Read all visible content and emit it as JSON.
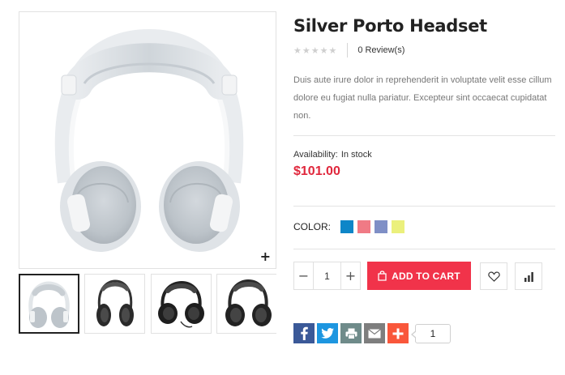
{
  "product": {
    "title": "Silver Porto Headset",
    "reviews_label": "0 Review(s)",
    "rating_stars": "★★★★★",
    "rating": 0,
    "description": "Duis aute irure dolor in reprehenderit in voluptate velit esse cillum dolore eu fugiat nulla pariatur. Excepteur sint occaecat cupidatat non.",
    "availability_label": "Availability:",
    "availability_value": "In stock",
    "price": "$101.00"
  },
  "gallery": {
    "zoom_icon": "+",
    "thumbnails": [
      "white-headphones",
      "black-headphones-1",
      "black-headphones-2",
      "black-headphones-3"
    ]
  },
  "color": {
    "label": "COLOR:",
    "swatches": [
      "#0e86c8",
      "#f07a85",
      "#7f8fc6",
      "#ebf07c"
    ]
  },
  "cart": {
    "quantity": "1",
    "minus": "−",
    "plus": "+",
    "add_to_cart": "ADD TO CART"
  },
  "actions": {
    "wishlist_icon": "heart-icon",
    "compare_icon": "bar-chart-icon"
  },
  "share": {
    "count": "1",
    "colors": {
      "facebook": "#3b5998",
      "twitter": "#1d96e0",
      "print": "#6f8b8a",
      "email": "#7e7e7e",
      "more": "#f9573b"
    }
  }
}
